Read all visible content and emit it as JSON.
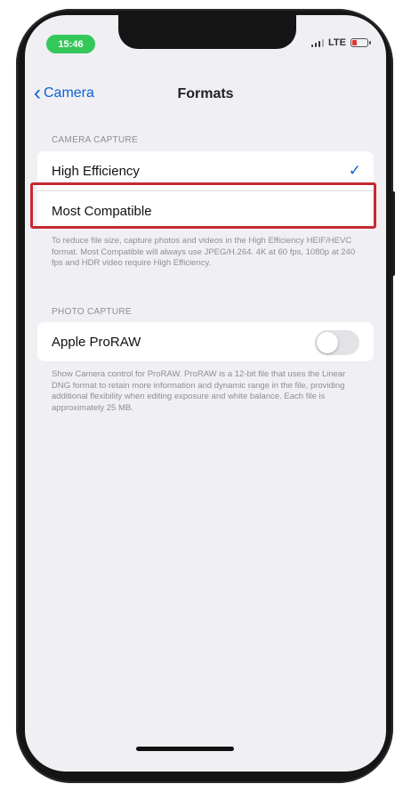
{
  "status_bar": {
    "time": "15:46",
    "network": "LTE"
  },
  "nav": {
    "back_label": "Camera",
    "title": "Formats"
  },
  "camera_capture": {
    "header": "CAMERA CAPTURE",
    "options": [
      {
        "label": "High Efficiency",
        "selected": true
      },
      {
        "label": "Most Compatible",
        "selected": false
      }
    ],
    "footer": "To reduce file size, capture photos and videos in the High Efficiency HEIF/HEVC format. Most Compatible will always use JPEG/H.264. 4K at 60 fps, 1080p at 240 fps and HDR video require High Efficiency."
  },
  "photo_capture": {
    "header": "PHOTO CAPTURE",
    "proraw_label": "Apple ProRAW",
    "proraw_enabled": false,
    "footer": "Show Camera control for ProRAW. ProRAW is a 12-bit file that uses the Linear DNG format to retain more information and dynamic range in the file, providing additional flexibility when editing exposure and white balance. Each file is approximately 25 MB."
  },
  "colors": {
    "accent": "#0a63d8",
    "highlight": "#c32a30",
    "time_pill": "#34c759"
  },
  "icons": {
    "back": "chevron-left-icon",
    "selected": "checkmark-icon"
  }
}
